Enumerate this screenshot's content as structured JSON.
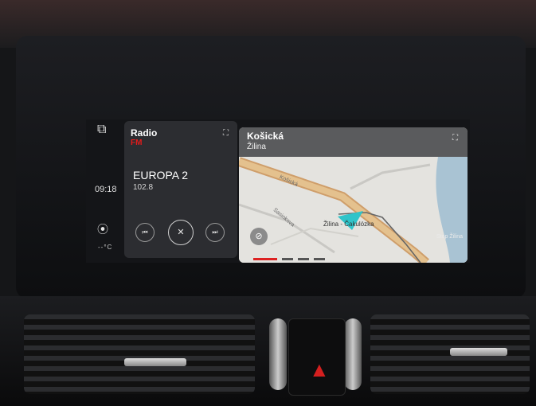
{
  "left_rail": {
    "clock": "09:18",
    "temperature": "--°C",
    "icons": [
      "phone-projection-icon",
      "location-pin-icon"
    ]
  },
  "radio": {
    "title": "Radio",
    "band": "FM",
    "station": "EUROPA 2",
    "frequency": "102.8",
    "controls": [
      "previous-icon",
      "mute-icon",
      "next-icon"
    ],
    "band_color": "#e21b1b"
  },
  "navigation": {
    "street": "Košická",
    "city": "Žilina",
    "road_label": "Košická",
    "road_label_2": "Sasinkova",
    "stop_label": "Žilina - Čakulózka",
    "side_label": "Stop Žilina",
    "nav_arrow_color": "#2fc4c9"
  }
}
